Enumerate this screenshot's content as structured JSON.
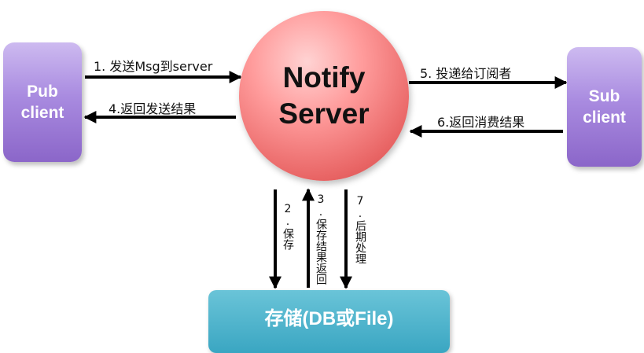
{
  "nodes": {
    "pub_client": "Pub\nclient",
    "sub_client": "Sub\nclient",
    "notify_server": "Notify\nServer",
    "storage": "存储(DB或File)"
  },
  "edges": {
    "e1": "1. 发送Msg到server",
    "e2": "2.保存",
    "e3": "3.保存结果返回",
    "e4": "4.返回发送结果",
    "e5": "5. 投递给订阅者",
    "e6": "6.返回消费结果",
    "e7": "7.后期处理"
  },
  "colors": {
    "client_box": "#a98be0",
    "server_circle": "#e86464",
    "storage_box": "#3aa6c2",
    "arrow": "#000000"
  }
}
